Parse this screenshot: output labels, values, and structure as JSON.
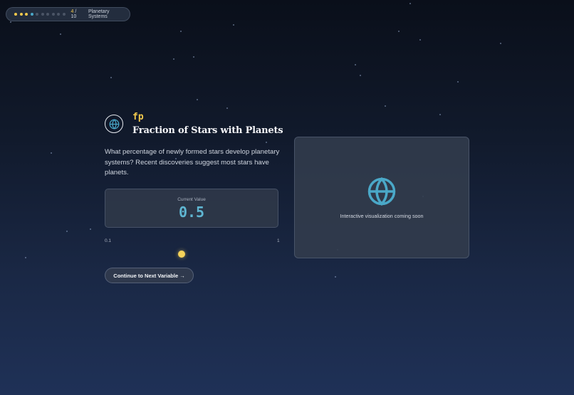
{
  "progress": {
    "current_step": "4",
    "separator_total": " / 10",
    "section": "Planetary Systems",
    "completed_fraction": 0.4
  },
  "variable": {
    "icon": "globe-icon",
    "symbol": "fp",
    "title": "Fraction of Stars with Planets",
    "description": "What percentage of newly formed stars develop planetary systems? Recent discoveries suggest most stars have planets."
  },
  "value_card": {
    "label": "Current Value",
    "value": "0.5"
  },
  "slider": {
    "min_label": "0.1",
    "max_label": "1",
    "min": 0.1,
    "max": 1,
    "value": 0.5
  },
  "next_button": {
    "label": "Continue to Next Variable →"
  },
  "visualization": {
    "icon": "globe-icon",
    "message": "Interactive visualization coming soon"
  },
  "colors": {
    "accent_yellow": "#f2c94c",
    "accent_cyan": "#4aa8c8"
  }
}
